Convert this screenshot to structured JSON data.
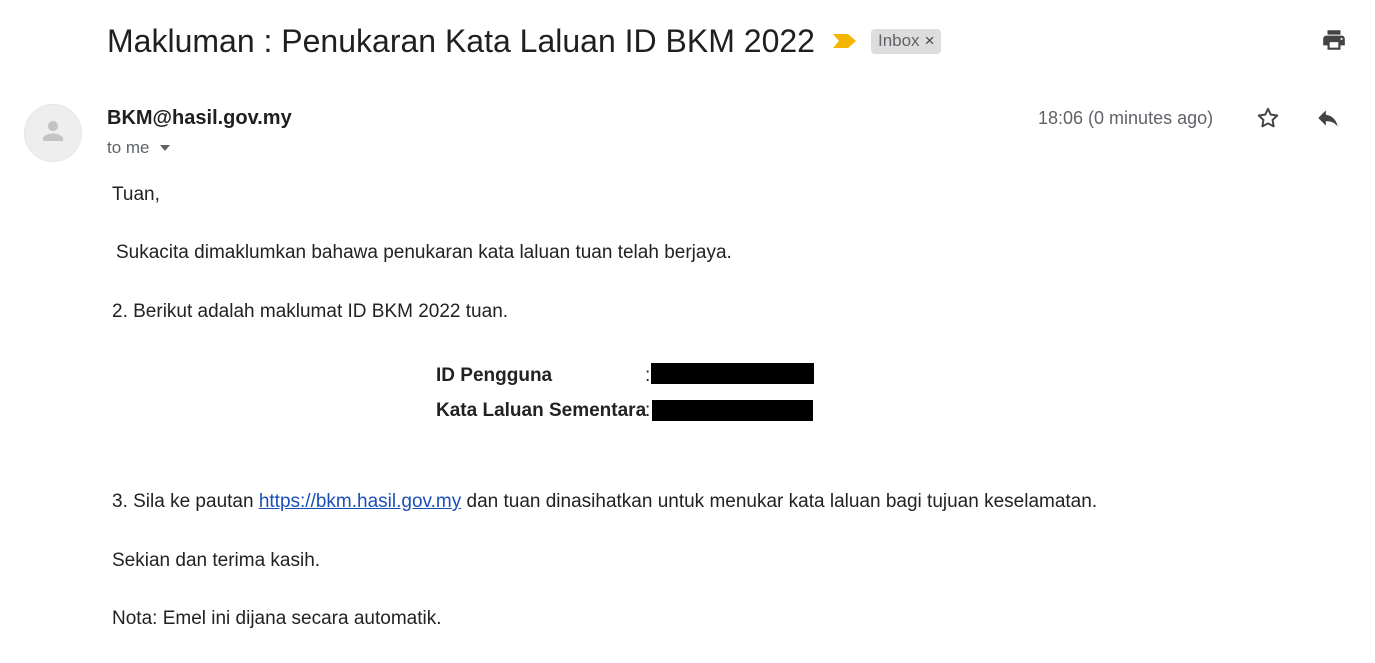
{
  "message": {
    "subject": "Makluman : Penukaran Kata Laluan ID BKM 2022",
    "label": "Inbox",
    "label_remove": "×",
    "importance_color": "#f4b400",
    "sender": "BKM@hasil.gov.my",
    "recipient": "to me",
    "timestamp": "18:06 (0 minutes ago)"
  },
  "body": {
    "greeting": "Tuan,",
    "intro": "Sukacita dimaklumkan bahawa penukaran kata laluan tuan telah berjaya.",
    "info": "2. Berikut adalah maklumat ID BKM 2022 tuan.",
    "credentials": {
      "user_label": "ID Pengguna",
      "pass_label": "Kata Laluan Sementara",
      "separator": ":"
    },
    "link_prefix": "3. Sila ke pautan ",
    "link_text": "https://bkm.hasil.gov.my",
    "link_suffix": " dan tuan dinasihatkan untuk menukar kata laluan bagi tujuan keselamatan.",
    "closing": "Sekian dan terima kasih.",
    "note": "Nota: Emel ini dijana secara automatik."
  },
  "icons": {
    "importance": "importance-marker-icon",
    "print": "print-icon",
    "avatar": "person-icon",
    "caret": "caret-down-icon",
    "star": "star-icon",
    "reply": "reply-icon"
  }
}
